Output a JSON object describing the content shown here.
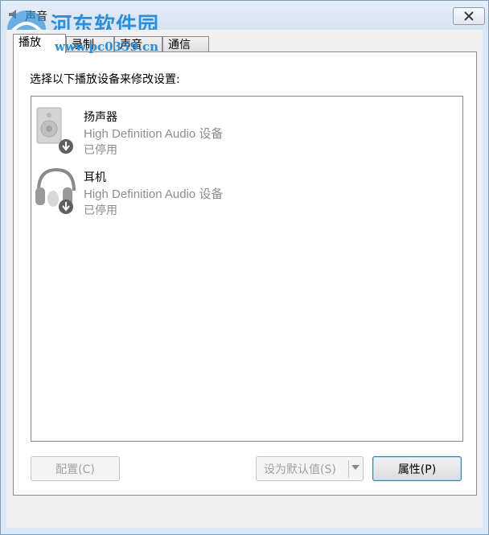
{
  "window": {
    "title": "声音",
    "watermark": "河东软件园",
    "watermark_url": "www.pc0359.cn"
  },
  "tabs": [
    {
      "label": "播放"
    },
    {
      "label": "录制"
    },
    {
      "label": "声音"
    },
    {
      "label": "通信"
    }
  ],
  "panel": {
    "instruction": "选择以下播放设备来修改设置:"
  },
  "devices": [
    {
      "name": "扬声器",
      "description": "High Definition Audio 设备",
      "status": "已停用",
      "icon": "speaker-icon"
    },
    {
      "name": "耳机",
      "description": "High Definition Audio 设备",
      "status": "已停用",
      "icon": "headphones-icon"
    }
  ],
  "buttons": {
    "configure": "配置(C)",
    "set_default": "设为默认值(S)",
    "properties": "属性(P)"
  },
  "colors": {
    "watermark": "#2b8fd9",
    "disabled_text": "#8c8c8c",
    "window_border": "#7a9cbf"
  }
}
